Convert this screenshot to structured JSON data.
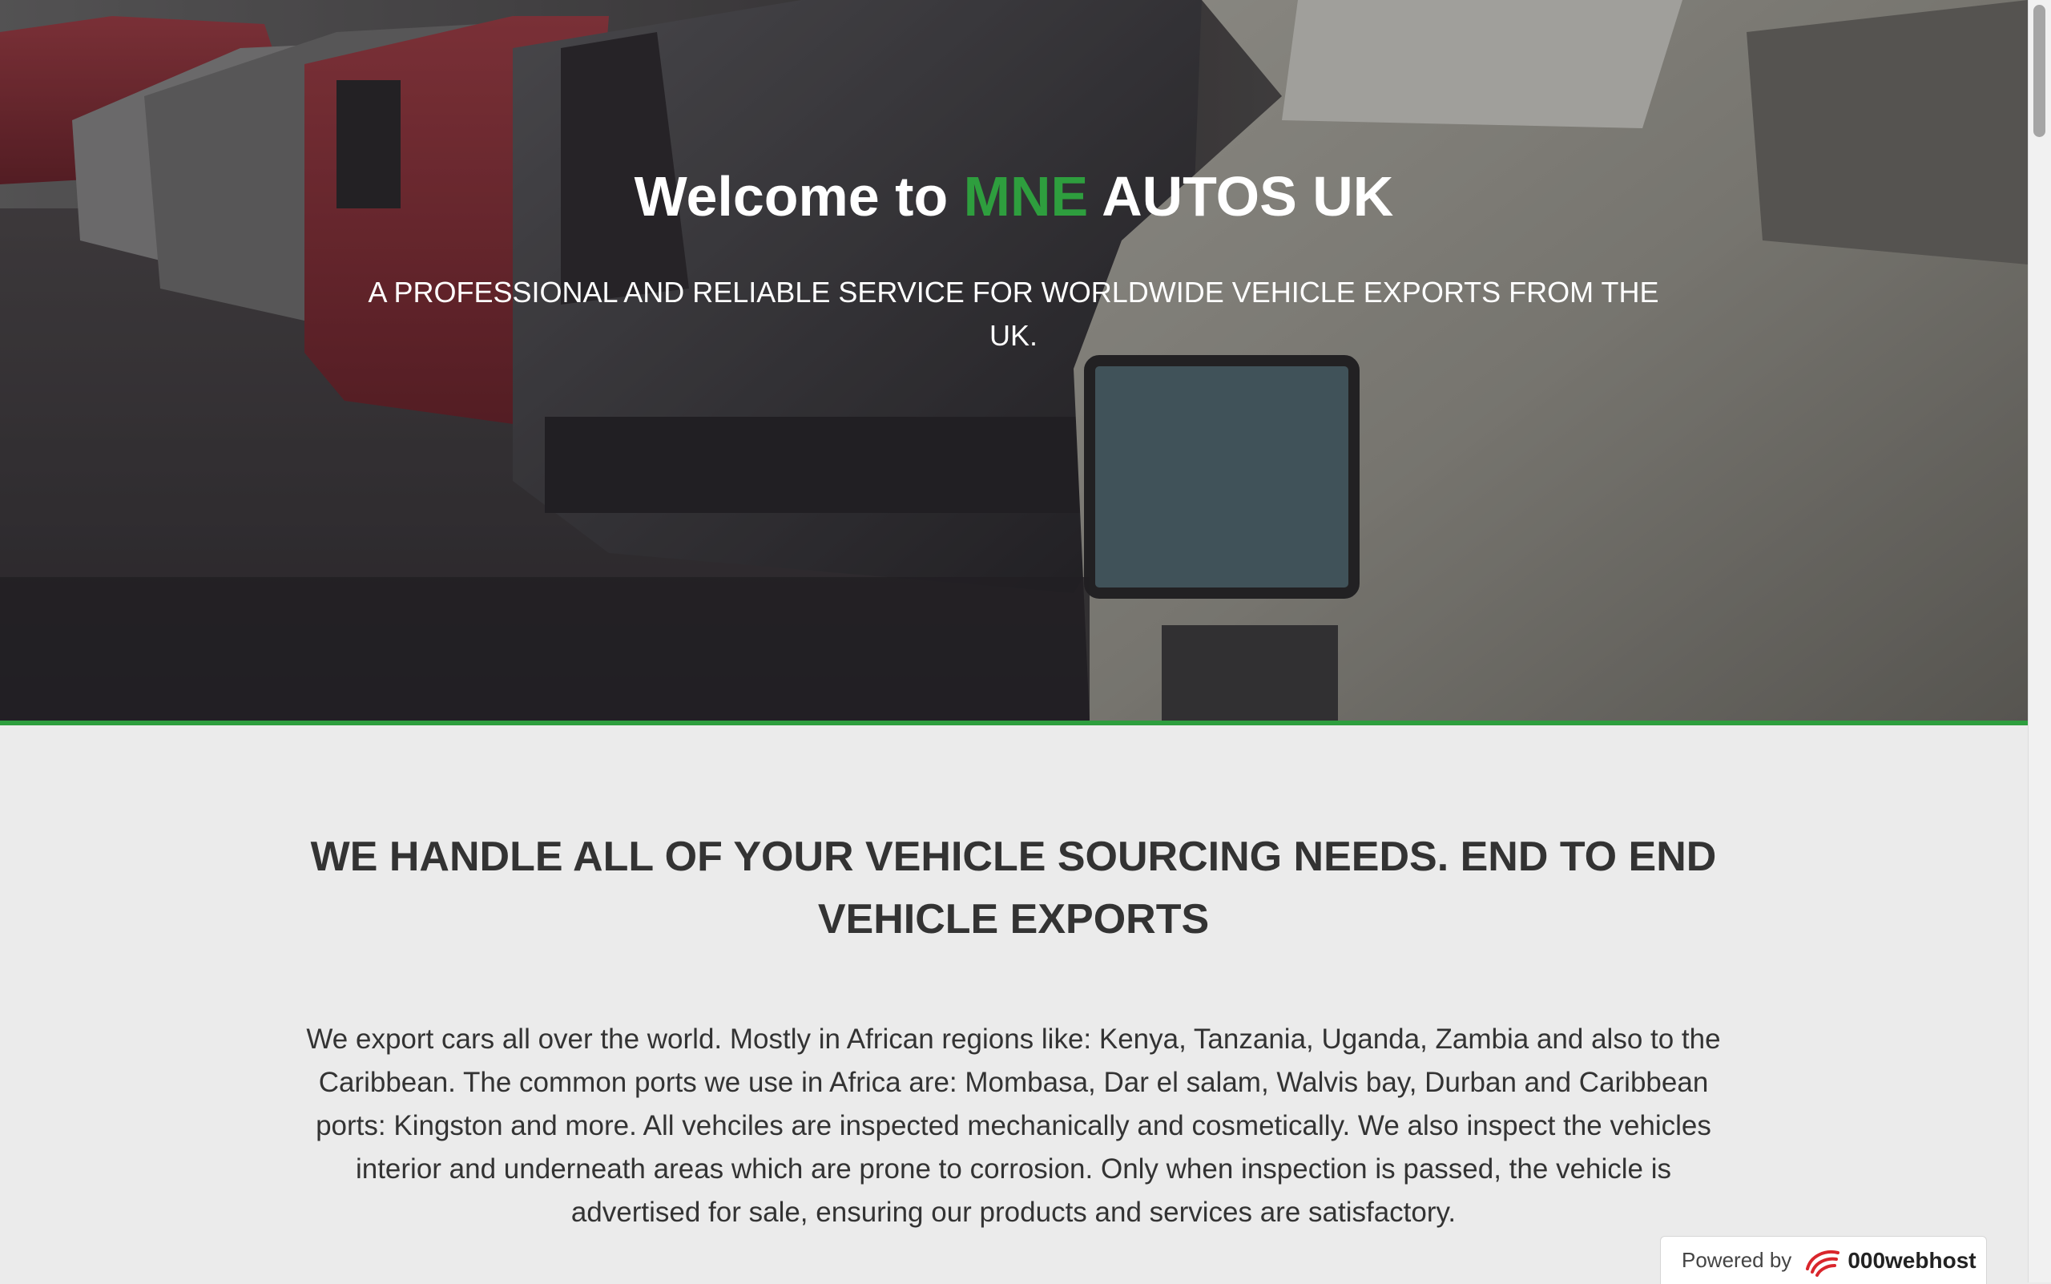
{
  "hero": {
    "title_prefix": "Welcome to ",
    "title_brand": "MNE",
    "title_suffix": " AUTOS UK",
    "subtitle": "A PROFESSIONAL AND RELIABLE SERVICE FOR WORLDWIDE VEHICLE EXPORTS FROM THE UK."
  },
  "main": {
    "heading": "WE HANDLE ALL OF YOUR VEHICLE SOURCING NEEDS. END TO END VEHICLE EXPORTS",
    "body": "We export cars all over the world. Mostly in African regions like: Kenya, Tanzania, Uganda, Zambia and also to the Caribbean. The common ports we use in Africa are: Mombasa, Dar el salam, Walvis bay, Durban and Caribbean ports: Kingston and more. All vehciles are inspected mechanically and cosmetically. We also inspect the vehicles interior and underneath areas which are prone to corrosion. Only when inspection is passed, the vehicle is advertised for sale, ensuring our products and services are satisfactory."
  },
  "badge": {
    "powered_label": "Powered by",
    "provider_name": "000webhost",
    "icon": "000webhost-logo-icon"
  },
  "colors": {
    "brand_green": "#2e9e3e",
    "page_background": "#ebebeb",
    "text_dark": "#333333"
  }
}
